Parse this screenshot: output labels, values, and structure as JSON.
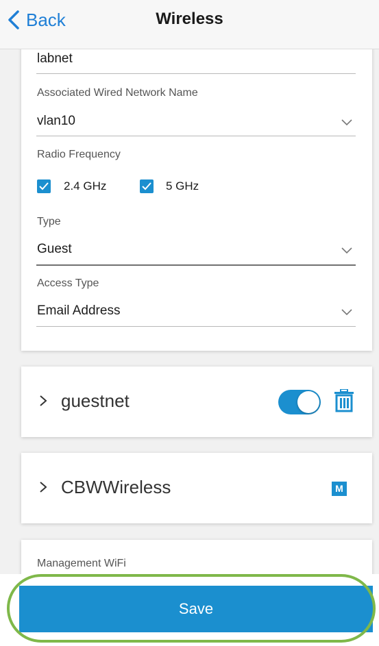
{
  "header": {
    "back_label": "Back",
    "title": "Wireless"
  },
  "form": {
    "ssid_value": "labnet",
    "wired_network_label": "Associated Wired Network Name",
    "wired_network_value": "vlan10",
    "radio_frequency_label": "Radio Frequency",
    "freq_24_label": "2.4 GHz",
    "freq_24_checked": true,
    "freq_5_label": "5 GHz",
    "freq_5_checked": true,
    "type_label": "Type",
    "type_value": "Guest",
    "access_type_label": "Access Type",
    "access_type_value": "Email Address"
  },
  "networks": [
    {
      "name": "guestnet",
      "enabled": true,
      "icon": "trash-icon"
    },
    {
      "name": "CBWWireless",
      "badge": "M"
    }
  ],
  "management": {
    "label": "Management WiFi"
  },
  "footer": {
    "save_label": "Save"
  },
  "colors": {
    "accent": "#1b8fcf",
    "link": "#1f7fd6",
    "highlight": "#7fb84a"
  }
}
